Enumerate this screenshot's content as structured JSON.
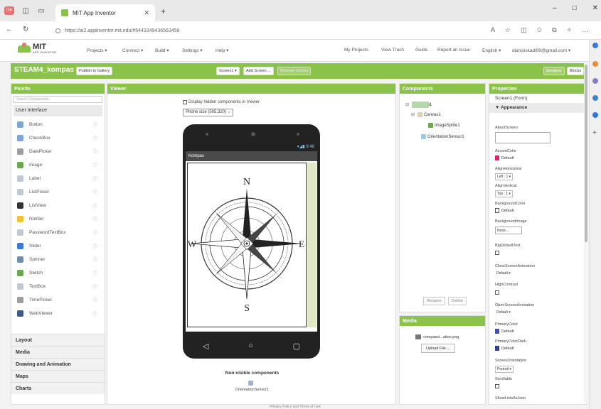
{
  "browser": {
    "tab_title": "MIT App Inventor",
    "url": "https://ai2.appinventor.mit.edu/#5443349436563456",
    "window_controls": [
      "–",
      "□",
      "✕"
    ]
  },
  "ai_header": {
    "logo_main": "MIT",
    "logo_sub": "APP INVENTOR",
    "menus": [
      "Projects ▾",
      "Connect ▾",
      "Build ▾",
      "Settings ▾",
      "Help ▾"
    ],
    "right_menus": [
      "My Projects",
      "View Trash",
      "Guide",
      "Report an Issue",
      "English ▾",
      "dianisiskadi09@gmail.com ▾"
    ]
  },
  "project": {
    "name": "STEAM4_kompas",
    "publish": "Publish to Gallery",
    "screen_select": "Screen1 ▾",
    "add_screen": "Add Screen ...",
    "remove_screen": "Remove Screen",
    "designer": "Designer",
    "blocks": "Blocks"
  },
  "palette": {
    "title": "Palette",
    "search_placeholder": "Search Components...",
    "ui_header": "User Interface",
    "items": [
      {
        "label": "Button",
        "color": "#7aa7d8"
      },
      {
        "label": "CheckBox",
        "color": "#7aa7d8"
      },
      {
        "label": "DatePicker",
        "color": "#9e9e9e"
      },
      {
        "label": "Image",
        "color": "#6aa84f"
      },
      {
        "label": "Label",
        "color": "#c0c8d4"
      },
      {
        "label": "ListPicker",
        "color": "#c0c8d4"
      },
      {
        "label": "ListView",
        "color": "#333333"
      },
      {
        "label": "Notifier",
        "color": "#f1c232"
      },
      {
        "label": "PasswordTextBox",
        "color": "#c0c8d4"
      },
      {
        "label": "Slider",
        "color": "#3c78d8"
      },
      {
        "label": "Spinner",
        "color": "#6f8faf"
      },
      {
        "label": "Switch",
        "color": "#6aa84f"
      },
      {
        "label": "TextBox",
        "color": "#c0c8d4"
      },
      {
        "label": "TimePicker",
        "color": "#9e9e9e"
      },
      {
        "label": "WebViewer",
        "color": "#3c5a8a"
      }
    ],
    "help": "ⓘ",
    "categories": [
      "Layout",
      "Media",
      "Drawing and Animation",
      "Maps",
      "Charts"
    ]
  },
  "viewer": {
    "title": "Viewer",
    "hidden_checkbox": "Display hidden components in Viewer",
    "phone_size": "Phone size (505,320) ⌵",
    "status_time": "▾◢▮ 9:48",
    "screen_title": "Kompas",
    "compass": {
      "n": "N",
      "s": "S",
      "e": "E",
      "w": "W"
    },
    "nav": [
      "◁",
      "○",
      "▢"
    ],
    "nonvisible_title": "Non-visible components",
    "nonvisible_item": "OrientationSensor1"
  },
  "components": {
    "title": "Components",
    "tree": [
      {
        "label": "Screen1",
        "toggle": "⊟"
      },
      {
        "label": "Canvas1",
        "toggle": "⊟"
      },
      {
        "label": "ImageSprite1",
        "toggle": ""
      },
      {
        "label": "OrientationSensor1",
        "toggle": ""
      }
    ],
    "rename": "Rename",
    "delete": "Delete"
  },
  "media": {
    "title": "Media",
    "file": "compassi...ation.png",
    "upload": "Upload File ..."
  },
  "properties": {
    "title": "Properties",
    "screen": "Screen1 (Form)",
    "section": "▼ Appearance",
    "about": "AboutScreen",
    "accent": "AccentColor",
    "accent_val": "Default",
    "alignh": "AlignHorizontal",
    "alignh_val": "Left : 1 ▾",
    "alignv": "AlignVertical",
    "alignv_val": "Top : 1 ▾",
    "bgcolor": "BackgroundColor",
    "bgcolor_val": "Default",
    "bgimage": "BackgroundImage",
    "bgimage_val": "None...",
    "bigtext": "BigDefaultText",
    "close_anim": "CloseScreenAnimation",
    "close_anim_val": "Default ▾",
    "highcontrast": "HighContrast",
    "open_anim": "OpenScreenAnimation",
    "open_anim_val": "Default ▾",
    "primary": "PrimaryColor",
    "primary_val": "Default",
    "primary_dark": "PrimaryColorDark",
    "primary_dark_val": "Default",
    "orientation": "ScreenOrientation",
    "orientation_val": "Portrait ▾",
    "scrollable": "Scrollable",
    "showlists": "ShowListsAsJson",
    "help": "?",
    "colors": {
      "accent": "#e91e63",
      "bg": "#ffffff",
      "primary": "#3f51b5",
      "primary_dark": "#303f9f"
    }
  },
  "footer": "Privacy Policy and Terms of Use"
}
